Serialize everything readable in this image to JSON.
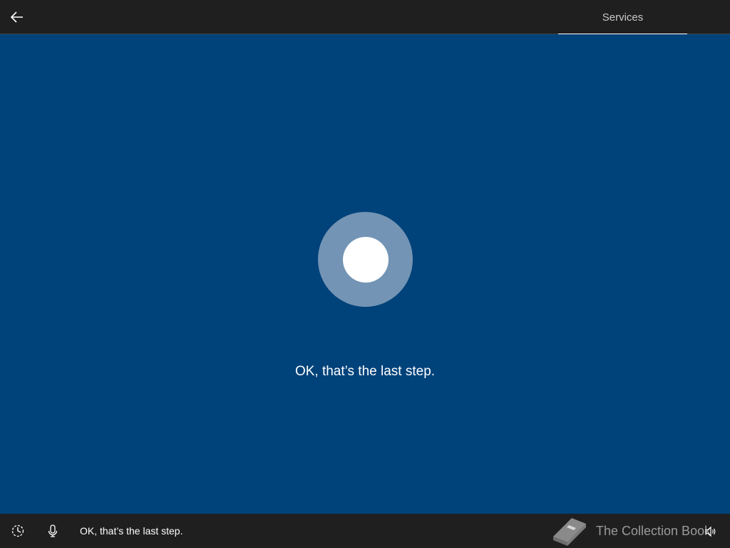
{
  "header": {
    "tab_label": "Services"
  },
  "main": {
    "message": "OK, that’s the last step."
  },
  "footer": {
    "message": "OK, that’s the last step.",
    "watermark": "The Collection Book"
  },
  "icons": {
    "back": "arrow-left-icon",
    "ease_of_access": "ease-of-access-icon",
    "mic": "microphone-icon",
    "volume": "volume-icon",
    "watermark_logo": "book-icon"
  },
  "colors": {
    "background": "#00427a",
    "bar": "#1f1f1f",
    "ring": "#7394b4",
    "text": "#ffffff"
  }
}
